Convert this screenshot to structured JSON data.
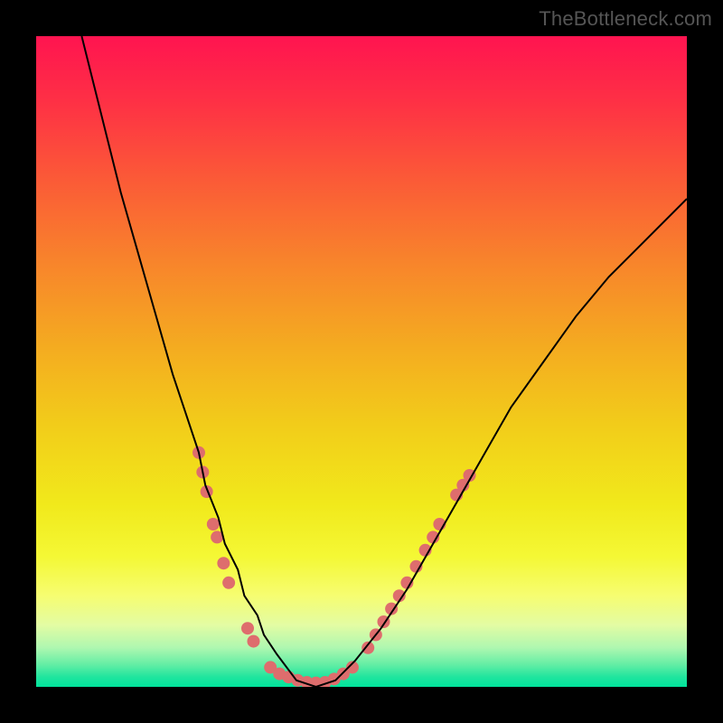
{
  "watermark": "TheBottleneck.com",
  "chart_data": {
    "type": "line",
    "title": "",
    "xlabel": "",
    "ylabel": "",
    "xlim": [
      0,
      100
    ],
    "ylim": [
      0,
      100
    ],
    "grid": false,
    "legend": false,
    "series": [
      {
        "name": "bottleneck-curve",
        "x": [
          7,
          9,
          11,
          13,
          15,
          17,
          19,
          21,
          23,
          25,
          26,
          28,
          29,
          31,
          32,
          34,
          35,
          37,
          40,
          43,
          46,
          49,
          53,
          57,
          61,
          65,
          69,
          73,
          78,
          83,
          88,
          93,
          100
        ],
        "y": [
          100,
          92,
          84,
          76,
          69,
          62,
          55,
          48,
          42,
          36,
          31,
          26,
          22,
          18,
          14,
          11,
          8,
          5,
          1,
          0,
          1,
          4,
          9,
          15,
          22,
          29,
          36,
          43,
          50,
          57,
          63,
          68,
          75
        ],
        "color": "#000000",
        "stroke_width": 2
      }
    ],
    "markers": [
      {
        "name": "left-cluster-upper",
        "color": "#de6d6d",
        "radius": 7,
        "points": [
          {
            "x": 25,
            "y": 36
          },
          {
            "x": 25.6,
            "y": 33
          },
          {
            "x": 26.2,
            "y": 30
          },
          {
            "x": 27.2,
            "y": 25
          },
          {
            "x": 27.8,
            "y": 23
          },
          {
            "x": 28.8,
            "y": 19
          },
          {
            "x": 29.6,
            "y": 16
          }
        ]
      },
      {
        "name": "left-cluster-lower",
        "color": "#de6d6d",
        "radius": 7,
        "points": [
          {
            "x": 32.5,
            "y": 9
          },
          {
            "x": 33.4,
            "y": 7
          }
        ]
      },
      {
        "name": "bottom-cluster",
        "color": "#de6d6d",
        "radius": 7,
        "points": [
          {
            "x": 36,
            "y": 3
          },
          {
            "x": 37.4,
            "y": 2
          },
          {
            "x": 38.8,
            "y": 1.5
          },
          {
            "x": 40.2,
            "y": 1
          },
          {
            "x": 41.6,
            "y": 0.7
          },
          {
            "x": 43,
            "y": 0.6
          },
          {
            "x": 44.4,
            "y": 0.7
          },
          {
            "x": 45.8,
            "y": 1.2
          },
          {
            "x": 47.2,
            "y": 2
          },
          {
            "x": 48.6,
            "y": 3
          }
        ]
      },
      {
        "name": "right-cluster",
        "color": "#de6d6d",
        "radius": 7,
        "points": [
          {
            "x": 51,
            "y": 6
          },
          {
            "x": 52.2,
            "y": 8
          },
          {
            "x": 53.4,
            "y": 10
          },
          {
            "x": 54.6,
            "y": 12
          },
          {
            "x": 55.8,
            "y": 14
          },
          {
            "x": 57,
            "y": 16
          },
          {
            "x": 58.4,
            "y": 18.5
          },
          {
            "x": 59.8,
            "y": 21
          },
          {
            "x": 61,
            "y": 23
          },
          {
            "x": 62,
            "y": 25
          },
          {
            "x": 64.6,
            "y": 29.5
          },
          {
            "x": 65.6,
            "y": 31
          },
          {
            "x": 66.6,
            "y": 32.5
          }
        ]
      }
    ],
    "background_gradient": {
      "type": "vertical",
      "stops": [
        {
          "offset": 0.0,
          "color": "#ff1450"
        },
        {
          "offset": 0.1,
          "color": "#fe3045"
        },
        {
          "offset": 0.22,
          "color": "#fb5a37"
        },
        {
          "offset": 0.35,
          "color": "#f8852b"
        },
        {
          "offset": 0.48,
          "color": "#f4ac20"
        },
        {
          "offset": 0.6,
          "color": "#f2cd1a"
        },
        {
          "offset": 0.72,
          "color": "#f1e91b"
        },
        {
          "offset": 0.8,
          "color": "#f4f835"
        },
        {
          "offset": 0.86,
          "color": "#f6fd71"
        },
        {
          "offset": 0.905,
          "color": "#e3fca3"
        },
        {
          "offset": 0.94,
          "color": "#aef7b0"
        },
        {
          "offset": 0.965,
          "color": "#66eea5"
        },
        {
          "offset": 0.985,
          "color": "#20e59e"
        },
        {
          "offset": 1.0,
          "color": "#00e39c"
        }
      ]
    }
  }
}
